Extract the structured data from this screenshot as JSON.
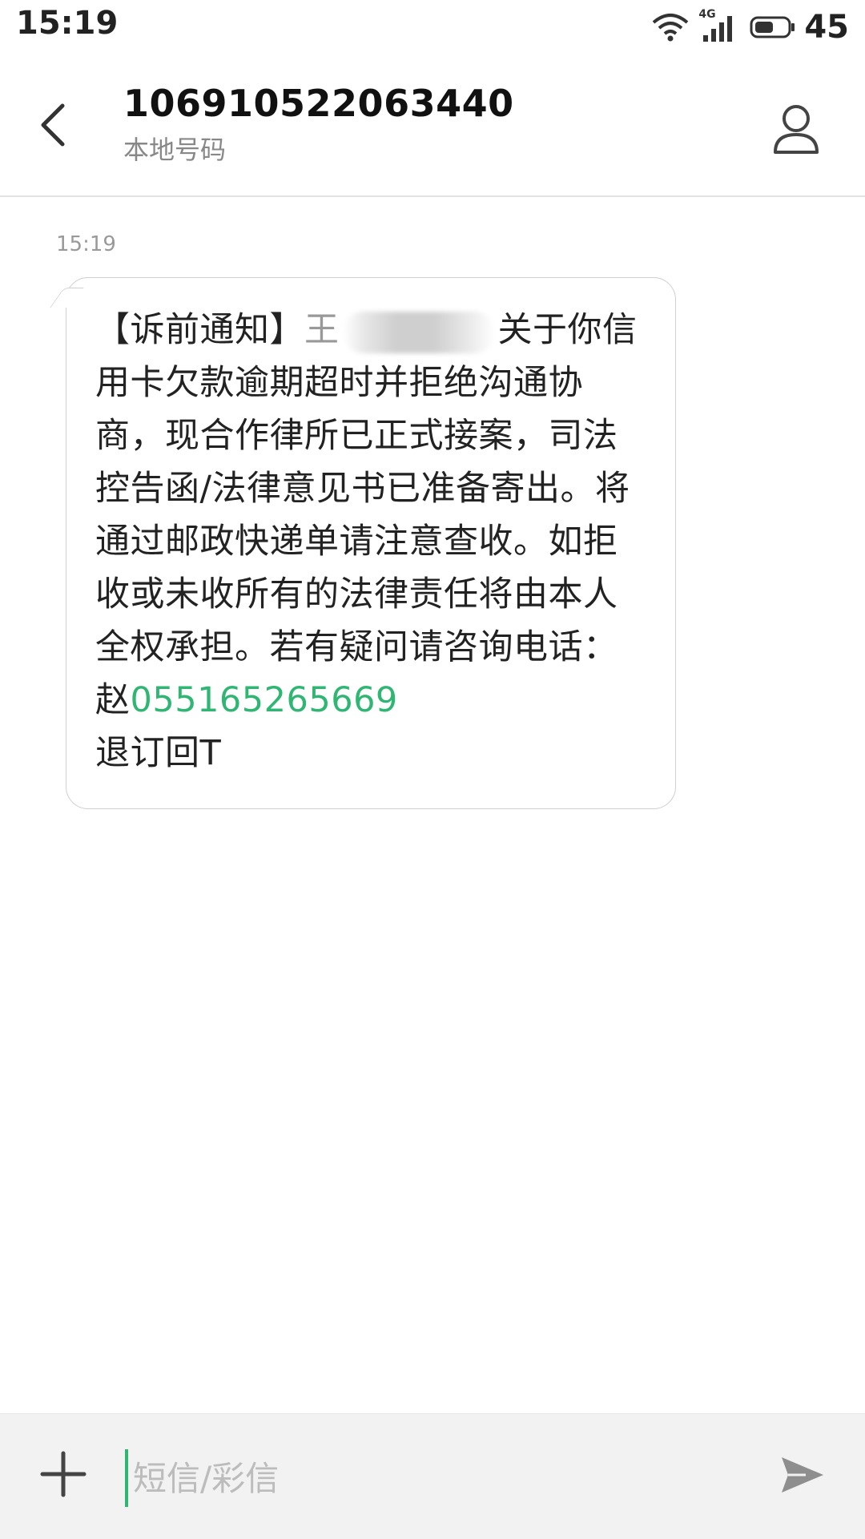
{
  "status_bar": {
    "time": "15:19",
    "network": "4G",
    "battery": "45"
  },
  "header": {
    "number": "106910522063440",
    "subtitle": "本地号码",
    "icons": {
      "back": "chevron-left-icon",
      "contact": "person-icon"
    }
  },
  "conversation": {
    "timestamp": "15:19",
    "message": {
      "part1": "【诉前通知】",
      "part1b": "王",
      "part2": "关于你信用卡欠款逾期超时并拒绝沟通协商，现合作律所已正式接案，司法控告函/法律意见书已准备寄出。将通过邮政快递单请注意查收。如拒收或未收所有的法律责任将由本人全权承担。若有疑问请咨询电话：赵",
      "phone": "055165265669",
      "part3": "退订回T"
    }
  },
  "composer": {
    "placeholder": "短信/彩信",
    "icons": {
      "add": "plus-icon",
      "send": "send-icon"
    }
  },
  "colors": {
    "accent": "#2fb673",
    "bubble_border": "#cfcfcf",
    "composer_bg": "#f2f2f2"
  }
}
